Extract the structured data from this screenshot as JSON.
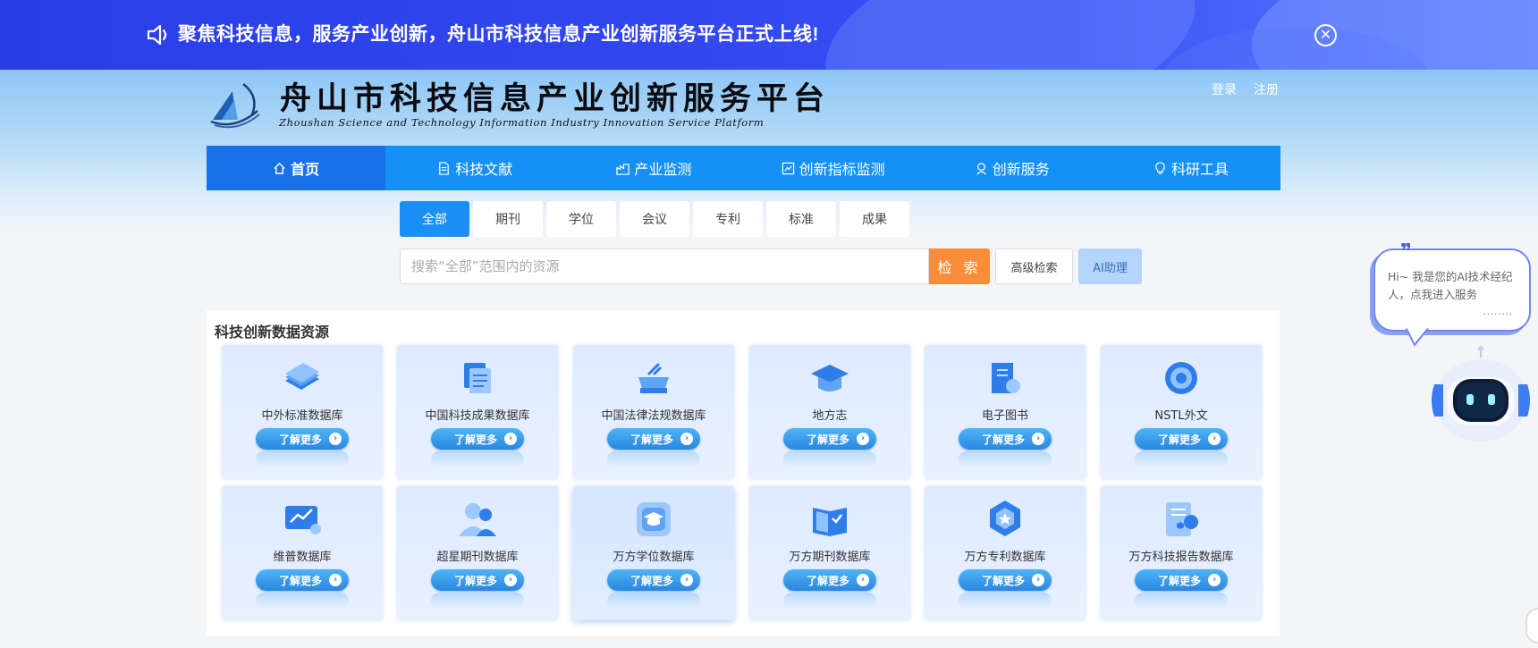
{
  "announcement": {
    "text": "聚焦科技信息，服务产业创新，舟山市科技信息产业创新服务平台正式上线!",
    "close_symbol": "✕"
  },
  "header": {
    "title": "舟山市科技信息产业创新服务平台",
    "subtitle": "Zhoushan Science and Technology Information Industry Innovation Service Platform",
    "login": "登录",
    "register": "注册"
  },
  "nav": {
    "items": [
      {
        "label": "首页",
        "icon": "home-icon"
      },
      {
        "label": "科技文献",
        "icon": "document-icon"
      },
      {
        "label": "产业监测",
        "icon": "factory-icon"
      },
      {
        "label": "创新指标监测",
        "icon": "chart-icon"
      },
      {
        "label": "创新服务",
        "icon": "service-icon"
      },
      {
        "label": "科研工具",
        "icon": "lightbulb-icon"
      }
    ]
  },
  "search": {
    "tabs": [
      "全部",
      "期刊",
      "学位",
      "会议",
      "专利",
      "标准",
      "成果"
    ],
    "active_tab": "全部",
    "placeholder": "搜索“全部”范围内的资源",
    "value": "",
    "search_button": "检 索",
    "advanced_button": "高级检索",
    "ai_button": "AI助理"
  },
  "resources": {
    "title": "科技创新数据资源",
    "more_label": "了解更多",
    "items": [
      {
        "name": "中外标准数据库",
        "icon": "book-stack-icon"
      },
      {
        "name": "中国科技成果数据库",
        "icon": "documents-icon"
      },
      {
        "name": "中国法律法规数据库",
        "icon": "law-icon"
      },
      {
        "name": "地方志",
        "icon": "graduation-cap-icon"
      },
      {
        "name": "电子图书",
        "icon": "ebook-icon"
      },
      {
        "name": "NSTL外文",
        "icon": "target-icon"
      },
      {
        "name": "维普数据库",
        "icon": "presentation-icon"
      },
      {
        "name": "超星期刊数据库",
        "icon": "users-icon"
      },
      {
        "name": "万方学位数据库",
        "icon": "degree-icon"
      },
      {
        "name": "万方期刊数据库",
        "icon": "open-book-icon"
      },
      {
        "name": "万方专利数据库",
        "icon": "patent-badge-icon"
      },
      {
        "name": "万方科技报告数据库",
        "icon": "report-icon"
      }
    ]
  },
  "assistant": {
    "bubble_text": "Hi~ 我是您的AI技术经纪人，点我进入服务",
    "quote": "❞",
    "dots": "········"
  },
  "colors": {
    "announcement_blue": "#2a3ee8",
    "nav_blue": "#1591f5",
    "nav_active": "#1871e8",
    "search_orange": "#fb8d3a",
    "ai_button": "#b3d4fb"
  }
}
